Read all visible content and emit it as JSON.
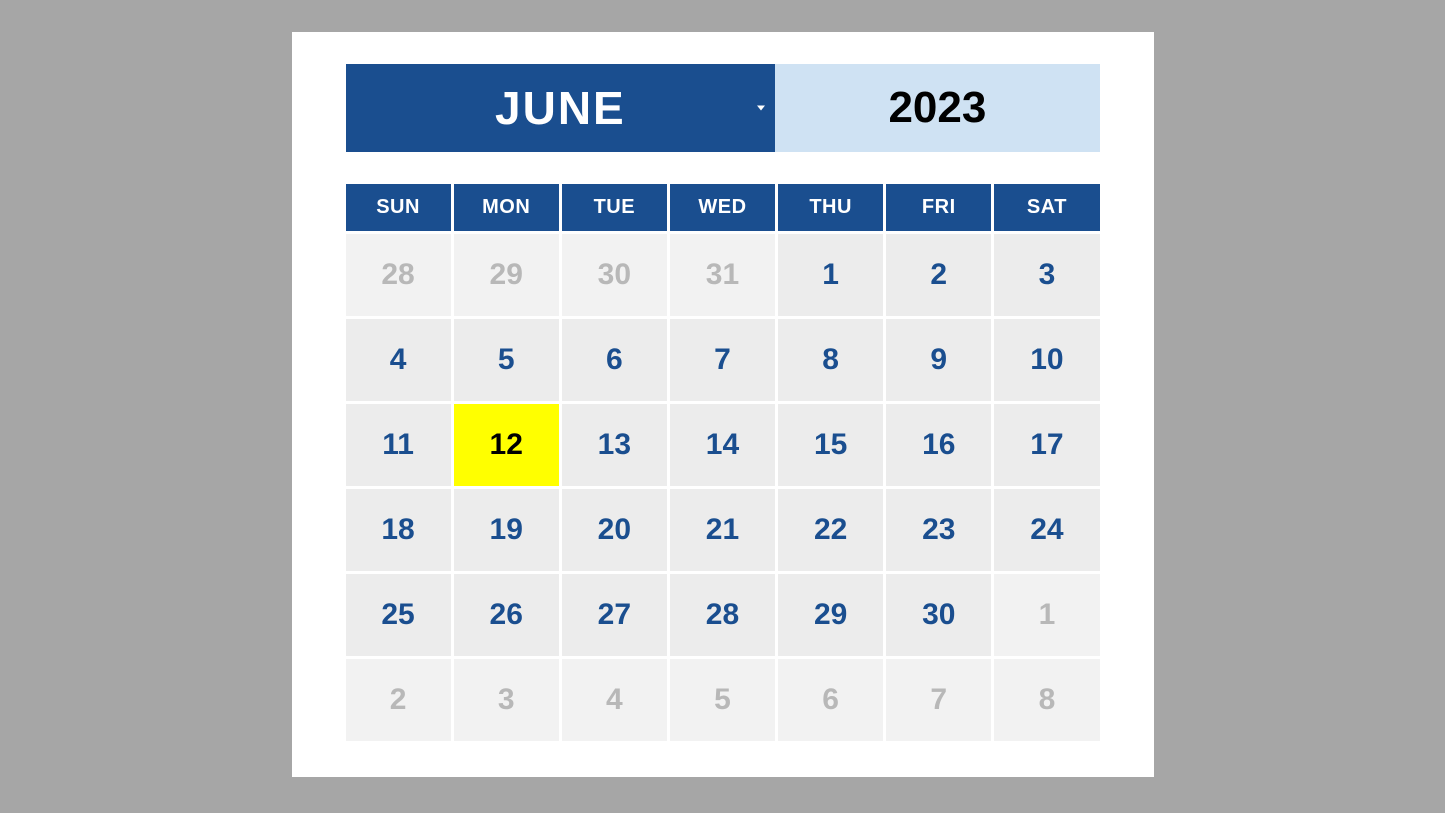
{
  "header": {
    "month": "JUNE",
    "year": "2023"
  },
  "dow": [
    "SUN",
    "MON",
    "TUE",
    "WED",
    "THU",
    "FRI",
    "SAT"
  ],
  "weeks": [
    [
      {
        "d": "28",
        "other": true
      },
      {
        "d": "29",
        "other": true
      },
      {
        "d": "30",
        "other": true
      },
      {
        "d": "31",
        "other": true
      },
      {
        "d": "1"
      },
      {
        "d": "2"
      },
      {
        "d": "3"
      }
    ],
    [
      {
        "d": "4"
      },
      {
        "d": "5"
      },
      {
        "d": "6"
      },
      {
        "d": "7"
      },
      {
        "d": "8"
      },
      {
        "d": "9"
      },
      {
        "d": "10"
      }
    ],
    [
      {
        "d": "11"
      },
      {
        "d": "12",
        "highlight": true
      },
      {
        "d": "13"
      },
      {
        "d": "14"
      },
      {
        "d": "15"
      },
      {
        "d": "16"
      },
      {
        "d": "17"
      }
    ],
    [
      {
        "d": "18"
      },
      {
        "d": "19"
      },
      {
        "d": "20"
      },
      {
        "d": "21"
      },
      {
        "d": "22"
      },
      {
        "d": "23"
      },
      {
        "d": "24"
      }
    ],
    [
      {
        "d": "25"
      },
      {
        "d": "26"
      },
      {
        "d": "27"
      },
      {
        "d": "28"
      },
      {
        "d": "29"
      },
      {
        "d": "30"
      },
      {
        "d": "1",
        "other": true
      }
    ],
    [
      {
        "d": "2",
        "other": true
      },
      {
        "d": "3",
        "other": true
      },
      {
        "d": "4",
        "other": true
      },
      {
        "d": "5",
        "other": true
      },
      {
        "d": "6",
        "other": true
      },
      {
        "d": "7",
        "other": true
      },
      {
        "d": "8",
        "other": true
      }
    ]
  ]
}
